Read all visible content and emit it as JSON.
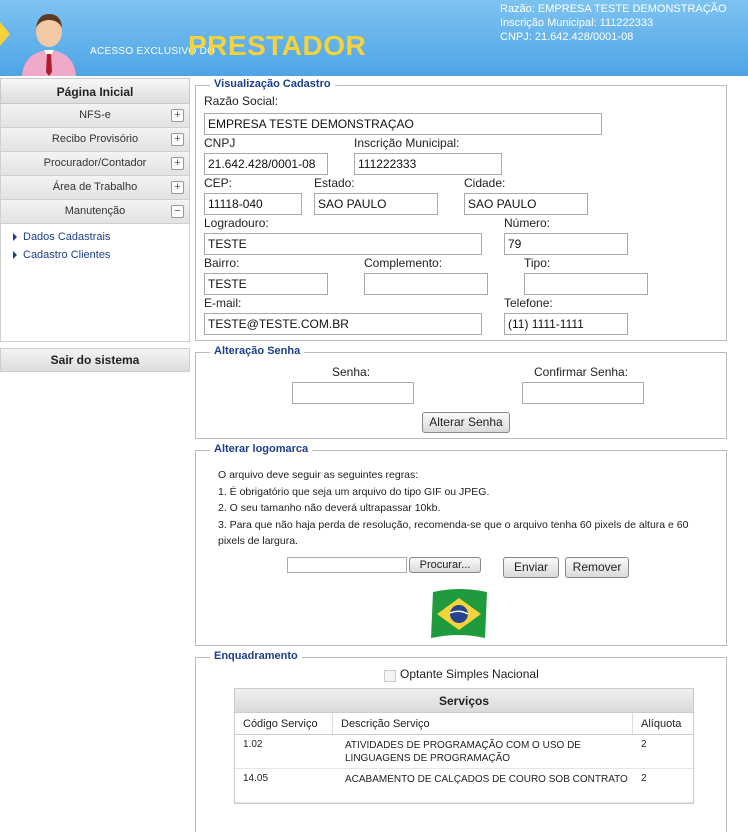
{
  "header": {
    "brand_small": "ACESSO EXCLUSIVO DO",
    "brand_big": "PRESTADOR",
    "company_name": "Razão: EMPRESA TESTE DEMONSTRAÇÃO",
    "company_im": "Inscrição Municipal: 111222333",
    "company_cnpj": "CNPJ: 21.642.428/0001-08"
  },
  "sidebar": {
    "title": "Página Inicial",
    "items": [
      {
        "label": "NFS-e",
        "toggle": "+"
      },
      {
        "label": "Recibo Provisório",
        "toggle": "+"
      },
      {
        "label": "Procurador/Contador",
        "toggle": "+"
      },
      {
        "label": "Área de Trabalho",
        "toggle": "+"
      },
      {
        "label": "Manutenção",
        "toggle": "−"
      }
    ],
    "submenu": [
      "Dados Cadastrais",
      "Cadastro Clientes"
    ],
    "logout": "Sair do sistema"
  },
  "cadastro": {
    "legend": "Visualização Cadastro",
    "razao_label": "Razão Social:",
    "razao_value": "EMPRESA TESTE DEMONSTRAÇAO",
    "cnpj_label": "CNPJ",
    "cnpj_value": "21.642.428/0001-08",
    "im_label": "Inscrição Municipal:",
    "im_value": "111222333",
    "cep_label": "CEP:",
    "cep_value": "11118-040",
    "estado_label": "Estado:",
    "estado_value": "SAO PAULO",
    "cidade_label": "Cidade:",
    "cidade_value": "SAO PAULO",
    "logradouro_label": "Logradouro:",
    "logradouro_value": "TESTE",
    "numero_label": "Número:",
    "numero_value": "79",
    "bairro_label": "Bairro:",
    "bairro_value": "TESTE",
    "complemento_label": "Complemento:",
    "complemento_value": "",
    "tipo_label": "Tipo:",
    "tipo_value": "",
    "email_label": "E-mail:",
    "email_value": "TESTE@TESTE.COM.BR",
    "telefone_label": "Telefone:",
    "telefone_value": "(11) 1111-1111"
  },
  "senha": {
    "legend": "Alteração Senha",
    "senha_label": "Senha:",
    "confirmar_label": "Confirmar Senha:",
    "button": "Alterar Senha"
  },
  "logo": {
    "legend": "Alterar logomarca",
    "rules": [
      "O arquivo deve seguir as seguintes regras:",
      "1. É obrigatório que seja um arquivo do tipo GIF ou JPEG.",
      "2. O seu tamanho não deverá ultrapassar 10kb.",
      "3. Para que não haja perda de resolução, recomenda-se que o arquivo tenha 60 pixels de altura e 60 pixels de largura."
    ],
    "browse_button": "Procurar...",
    "send_button": "Enviar",
    "remove_button": "Remover",
    "image": "brazil-flag"
  },
  "enquadramento": {
    "legend": "Enquadramento",
    "simples_label": "Optante Simples Nacional",
    "simples_checked": false,
    "services_title": "Serviços",
    "columns": [
      "Código Serviço",
      "Descrição Serviço",
      "Alíquota"
    ],
    "rows": [
      {
        "codigo": "1.02",
        "descricao": "ATIVIDADES DE PROGRAMAÇÃO COM O USO DE LINGUAGENS DE PROGRAMAÇÃO",
        "aliquota": "2"
      },
      {
        "codigo": "14.05",
        "descricao": "ACABAMENTO DE CALÇADOS DE COURO SOB CONTRATO",
        "aliquota": "2"
      }
    ]
  }
}
